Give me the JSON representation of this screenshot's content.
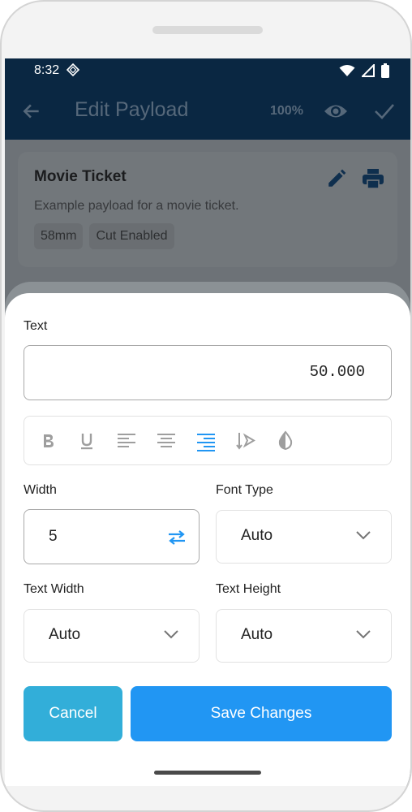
{
  "status_bar": {
    "time": "8:32"
  },
  "app_bar": {
    "title": "Edit Payload",
    "zoom": "100%"
  },
  "ticket": {
    "title": "Movie Ticket",
    "description": "Example payload for a movie ticket.",
    "chips": [
      "58mm",
      "Cut Enabled"
    ]
  },
  "sheet": {
    "text_label": "Text",
    "text_value": "50.000",
    "format_bar": {
      "icons": [
        "bold-icon",
        "underline-icon",
        "align-left-icon",
        "align-center-icon",
        "align-right-icon",
        "text-direction-icon",
        "invert-contrast-icon"
      ],
      "active": "align-right-icon",
      "active_color": "#2196f3",
      "inactive_color": "#9e9e9e"
    },
    "width_label": "Width",
    "width_value": "5",
    "font_type_label": "Font Type",
    "font_type_value": "Auto",
    "text_width_label": "Text Width",
    "text_width_value": "Auto",
    "text_height_label": "Text Height",
    "text_height_value": "Auto",
    "cancel_label": "Cancel",
    "save_label": "Save Changes"
  },
  "colors": {
    "app_bar": "#0a2742",
    "cancel_button": "#32aed9",
    "save_button": "#2196f3"
  }
}
